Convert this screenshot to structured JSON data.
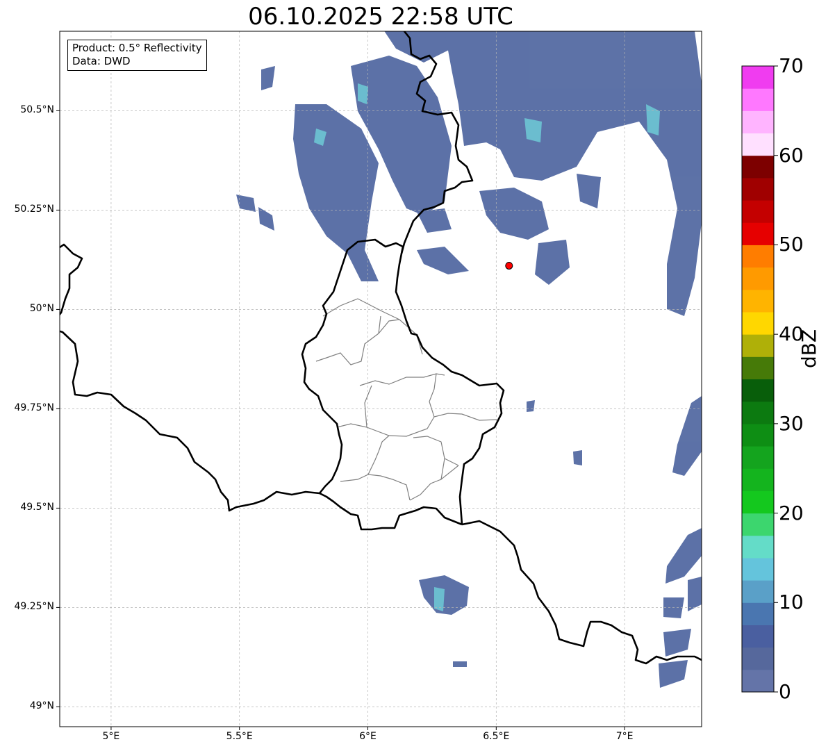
{
  "title": "06.10.2025 22:58 UTC",
  "info_box": {
    "product": "Product: 0.5° Reflectivity",
    "data": "Data: DWD"
  },
  "map": {
    "projection": "PlateCarree",
    "lon_range": [
      4.8,
      7.3
    ],
    "lat_range": [
      48.95,
      50.7
    ],
    "lat_ticks": [
      {
        "value": 50.5,
        "label": "50.5°N"
      },
      {
        "value": 50.25,
        "label": "50.25°N"
      },
      {
        "value": 50.0,
        "label": "50°N"
      },
      {
        "value": 49.75,
        "label": "49.75°N"
      },
      {
        "value": 49.5,
        "label": "49.5°N"
      },
      {
        "value": 49.25,
        "label": "49.25°N"
      },
      {
        "value": 49.0,
        "label": "49°N"
      }
    ],
    "lon_ticks": [
      {
        "value": 5.0,
        "label": "5°E"
      },
      {
        "value": 5.5,
        "label": "5.5°E"
      },
      {
        "value": 6.0,
        "label": "6°E"
      },
      {
        "value": 6.5,
        "label": "6.5°E"
      },
      {
        "value": 7.0,
        "label": "7°E"
      }
    ],
    "radar_site": {
      "lon": 6.55,
      "lat": 50.11,
      "color": "#ff0000"
    },
    "grid": true
  },
  "colorbar": {
    "label": "dBZ",
    "min": 0,
    "max": 70,
    "step": 2.5,
    "tick_labels": [
      "0",
      "10",
      "20",
      "30",
      "40",
      "50",
      "60",
      "70"
    ],
    "colors": [
      "#6474a8",
      "#56689c",
      "#4a5fa0",
      "#4a76b0",
      "#5aa0c8",
      "#64c4dc",
      "#64dcc8",
      "#3cd66e",
      "#14c81e",
      "#14b41e",
      "#14a41e",
      "#0e8e14",
      "#0c7a10",
      "#085e0a",
      "#467a08",
      "#afb008",
      "#ffd700",
      "#ffb400",
      "#ff9a00",
      "#ff7d00",
      "#e60000",
      "#c40000",
      "#a00000",
      "#7d0000",
      "#ffe0ff",
      "#ffb4ff",
      "#ff78ff",
      "#f03cf0"
    ]
  }
}
